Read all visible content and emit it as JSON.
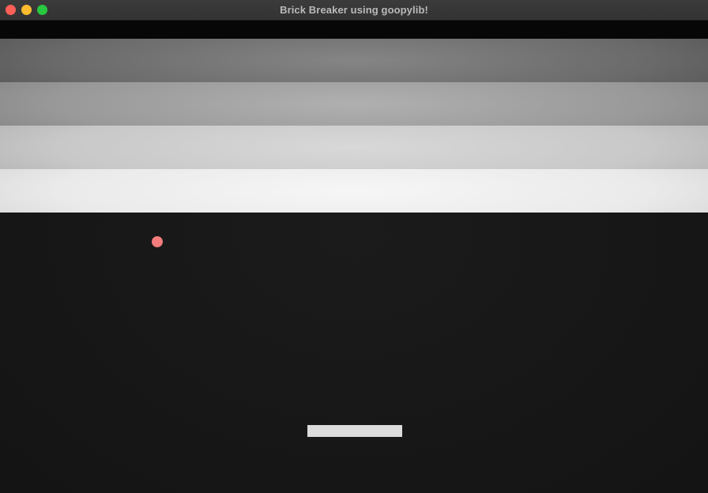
{
  "window": {
    "title": "Brick Breaker using goopylib!"
  },
  "game": {
    "brick_rows": 5,
    "ball": {
      "color": "#f47c7c"
    },
    "paddle": {
      "color": "#dcdcdc"
    }
  }
}
